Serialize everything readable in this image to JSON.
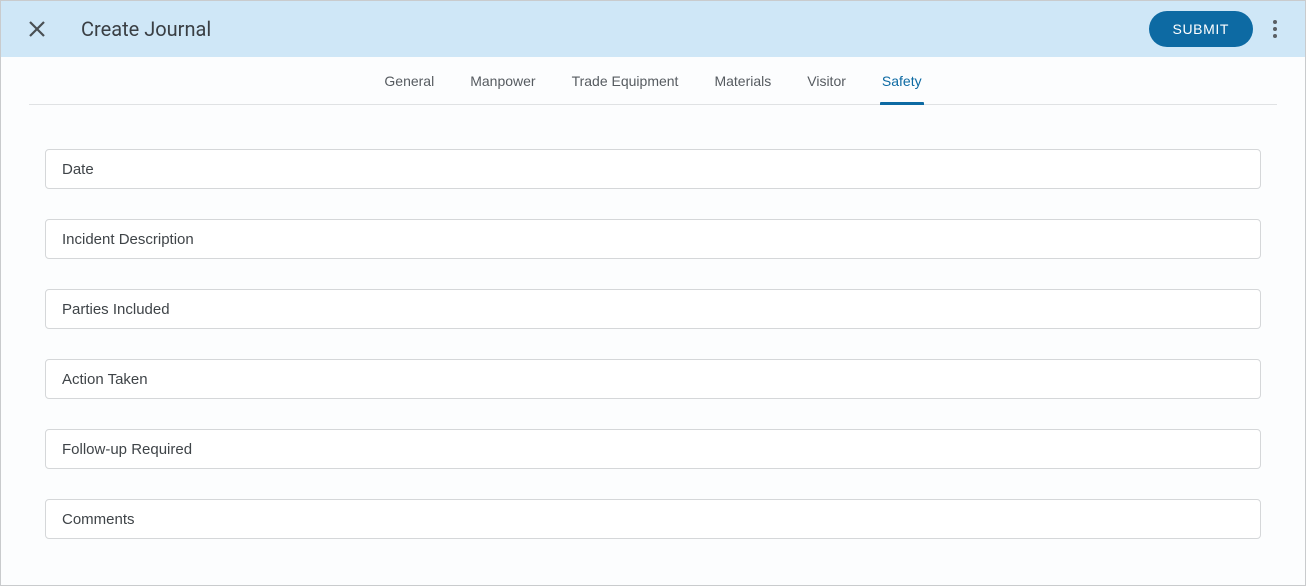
{
  "header": {
    "title": "Create Journal",
    "submit_label": "SUBMIT"
  },
  "tabs": [
    {
      "id": "general",
      "label": "General",
      "active": false
    },
    {
      "id": "manpower",
      "label": "Manpower",
      "active": false
    },
    {
      "id": "trade-equipment",
      "label": "Trade Equipment",
      "active": false
    },
    {
      "id": "materials",
      "label": "Materials",
      "active": false
    },
    {
      "id": "visitor",
      "label": "Visitor",
      "active": false
    },
    {
      "id": "safety",
      "label": "Safety",
      "active": true
    }
  ],
  "fields": [
    {
      "id": "date",
      "placeholder": "Date",
      "value": ""
    },
    {
      "id": "incident-description",
      "placeholder": "Incident Description",
      "value": ""
    },
    {
      "id": "parties-included",
      "placeholder": "Parties Included",
      "value": ""
    },
    {
      "id": "action-taken",
      "placeholder": "Action Taken",
      "value": ""
    },
    {
      "id": "follow-up-required",
      "placeholder": "Follow-up Required",
      "value": ""
    },
    {
      "id": "comments",
      "placeholder": "Comments",
      "value": ""
    }
  ]
}
